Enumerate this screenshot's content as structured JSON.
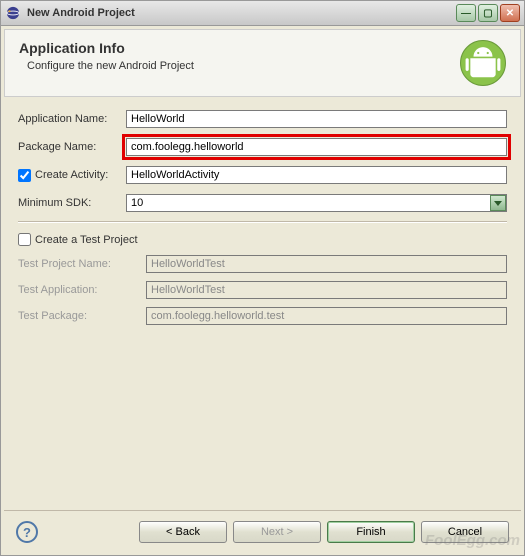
{
  "window": {
    "title": "New Android Project"
  },
  "header": {
    "title": "Application Info",
    "subtitle": "Configure the new Android Project"
  },
  "labels": {
    "application_name": "Application Name:",
    "package_name": "Package Name:",
    "create_activity": "Create Activity:",
    "minimum_sdk": "Minimum SDK:",
    "create_test_project": "Create a Test Project",
    "test_project_name": "Test Project Name:",
    "test_application": "Test Application:",
    "test_package": "Test Package:"
  },
  "fields": {
    "application_name": "HelloWorld",
    "package_name": "com.foolegg.helloworld",
    "create_activity_checked": true,
    "create_activity_value": "HelloWorldActivity",
    "minimum_sdk": "10",
    "create_test_project_checked": false,
    "test_project_name": "HelloWorldTest",
    "test_application": "HelloWorldTest",
    "test_package": "com.foolegg.helloworld.test"
  },
  "buttons": {
    "back": "< Back",
    "next": "Next >",
    "finish": "Finish",
    "cancel": "Cancel"
  },
  "watermark": "FoolEgg.com"
}
